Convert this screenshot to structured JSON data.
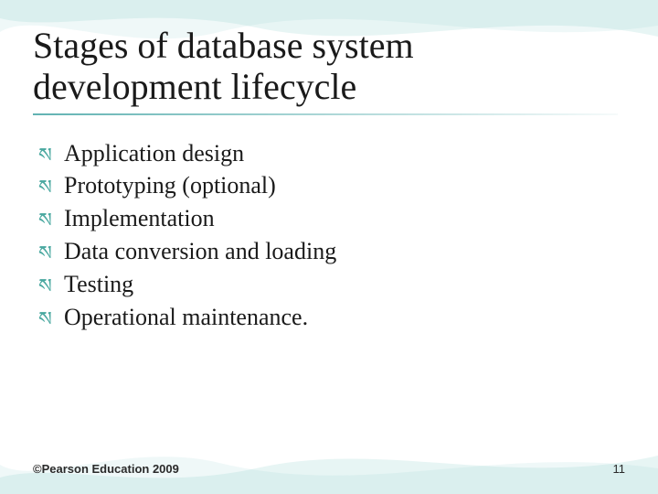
{
  "title_line1": "Stages of database system",
  "title_line2": "development lifecycle",
  "bullets": {
    "0": "Application design",
    "1": "Prototyping (optional)",
    "2": "Implementation",
    "3": "Data conversion and loading",
    "4": "Testing",
    "5": "Operational maintenance."
  },
  "footer": {
    "copyright": "©Pearson Education 2009",
    "page": "11"
  },
  "colors": {
    "accent": "#4aa8a0",
    "text": "#1a1a1a"
  }
}
